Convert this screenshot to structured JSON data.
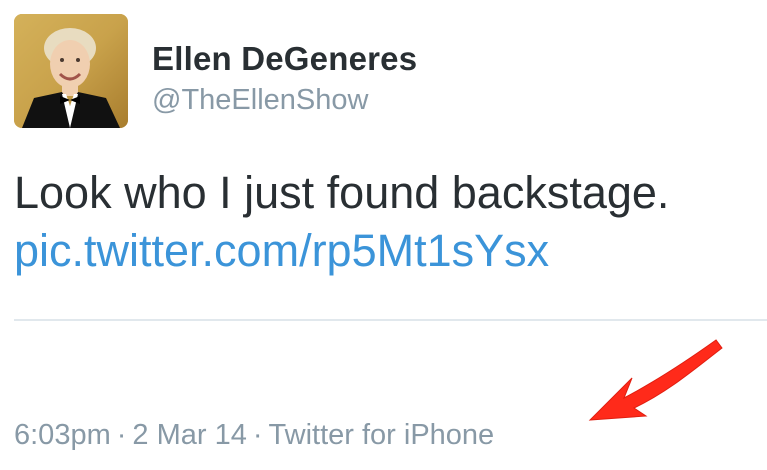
{
  "user": {
    "display_name": "Ellen DeGeneres",
    "screen_name": "@TheEllenShow",
    "avatar_icon": "profile-photo"
  },
  "tweet": {
    "text": "Look who I just found backstage.",
    "link": "pic.twitter.com/rp5Mt1sYsx"
  },
  "meta": {
    "time": "6:03pm",
    "separator": "·",
    "date": "2 Mar 14",
    "source": "Twitter for iPhone"
  },
  "annotation": {
    "icon": "red-arrow-icon",
    "color": "#ff2a1a"
  },
  "colors": {
    "link": "#3b94d9",
    "muted": "#8899a6",
    "text": "#292f33",
    "divider": "#e1e8ed"
  }
}
